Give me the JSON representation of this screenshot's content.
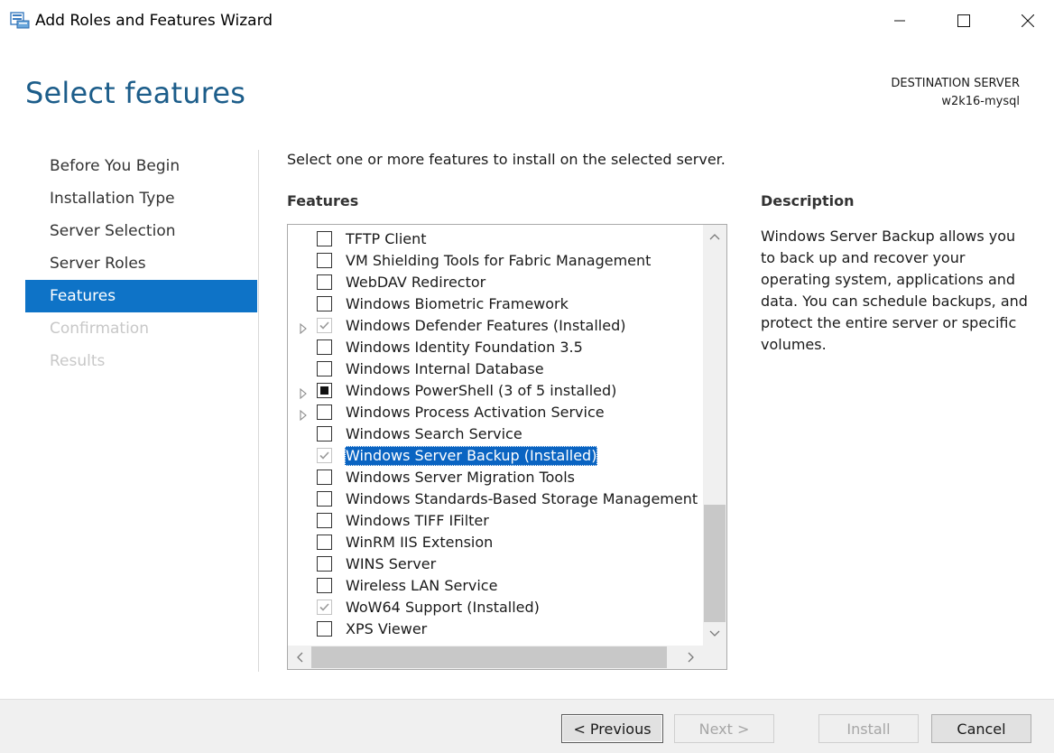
{
  "window": {
    "title": "Add Roles and Features Wizard",
    "icon": "wizard-server-icon"
  },
  "header": {
    "page_title": "Select features",
    "destination_label": "DESTINATION SERVER",
    "destination_name": "w2k16-mysql"
  },
  "nav": {
    "items": [
      {
        "label": "Before You Begin",
        "state": "normal"
      },
      {
        "label": "Installation Type",
        "state": "normal"
      },
      {
        "label": "Server Selection",
        "state": "normal"
      },
      {
        "label": "Server Roles",
        "state": "normal"
      },
      {
        "label": "Features",
        "state": "active"
      },
      {
        "label": "Confirmation",
        "state": "disabled"
      },
      {
        "label": "Results",
        "state": "disabled"
      }
    ]
  },
  "main": {
    "instruction": "Select one or more features to install on the selected server.",
    "features_heading": "Features",
    "features": [
      {
        "label": "TFTP Client",
        "state": "unchecked",
        "expandable": false
      },
      {
        "label": "VM Shielding Tools for Fabric Management",
        "state": "unchecked",
        "expandable": false
      },
      {
        "label": "WebDAV Redirector",
        "state": "unchecked",
        "expandable": false
      },
      {
        "label": "Windows Biometric Framework",
        "state": "unchecked",
        "expandable": false
      },
      {
        "label": "Windows Defender Features (Installed)",
        "state": "installed",
        "expandable": true
      },
      {
        "label": "Windows Identity Foundation 3.5",
        "state": "unchecked",
        "expandable": false
      },
      {
        "label": "Windows Internal Database",
        "state": "unchecked",
        "expandable": false
      },
      {
        "label": "Windows PowerShell (3 of 5 installed)",
        "state": "partial",
        "expandable": true
      },
      {
        "label": "Windows Process Activation Service",
        "state": "unchecked",
        "expandable": true
      },
      {
        "label": "Windows Search Service",
        "state": "unchecked",
        "expandable": false
      },
      {
        "label": "Windows Server Backup (Installed)",
        "state": "installed",
        "expandable": false,
        "selected": true
      },
      {
        "label": "Windows Server Migration Tools",
        "state": "unchecked",
        "expandable": false
      },
      {
        "label": "Windows Standards-Based Storage Management",
        "state": "unchecked",
        "expandable": false
      },
      {
        "label": "Windows TIFF IFilter",
        "state": "unchecked",
        "expandable": false
      },
      {
        "label": "WinRM IIS Extension",
        "state": "unchecked",
        "expandable": false
      },
      {
        "label": "WINS Server",
        "state": "unchecked",
        "expandable": false
      },
      {
        "label": "Wireless LAN Service",
        "state": "unchecked",
        "expandable": false
      },
      {
        "label": "WoW64 Support (Installed)",
        "state": "installed",
        "expandable": false
      },
      {
        "label": "XPS Viewer",
        "state": "unchecked",
        "expandable": false
      }
    ]
  },
  "description": {
    "heading": "Description",
    "text": "Windows Server Backup allows you to back up and recover your operating system, applications and data. You can schedule backups, and protect the entire server or specific volumes."
  },
  "footer": {
    "previous_label": "< Previous",
    "next_label": "Next >",
    "install_label": "Install",
    "cancel_label": "Cancel"
  },
  "colors": {
    "title_blue": "#1c5d8a",
    "nav_active": "#0e73c7",
    "selection_blue": "#0a64c2"
  }
}
